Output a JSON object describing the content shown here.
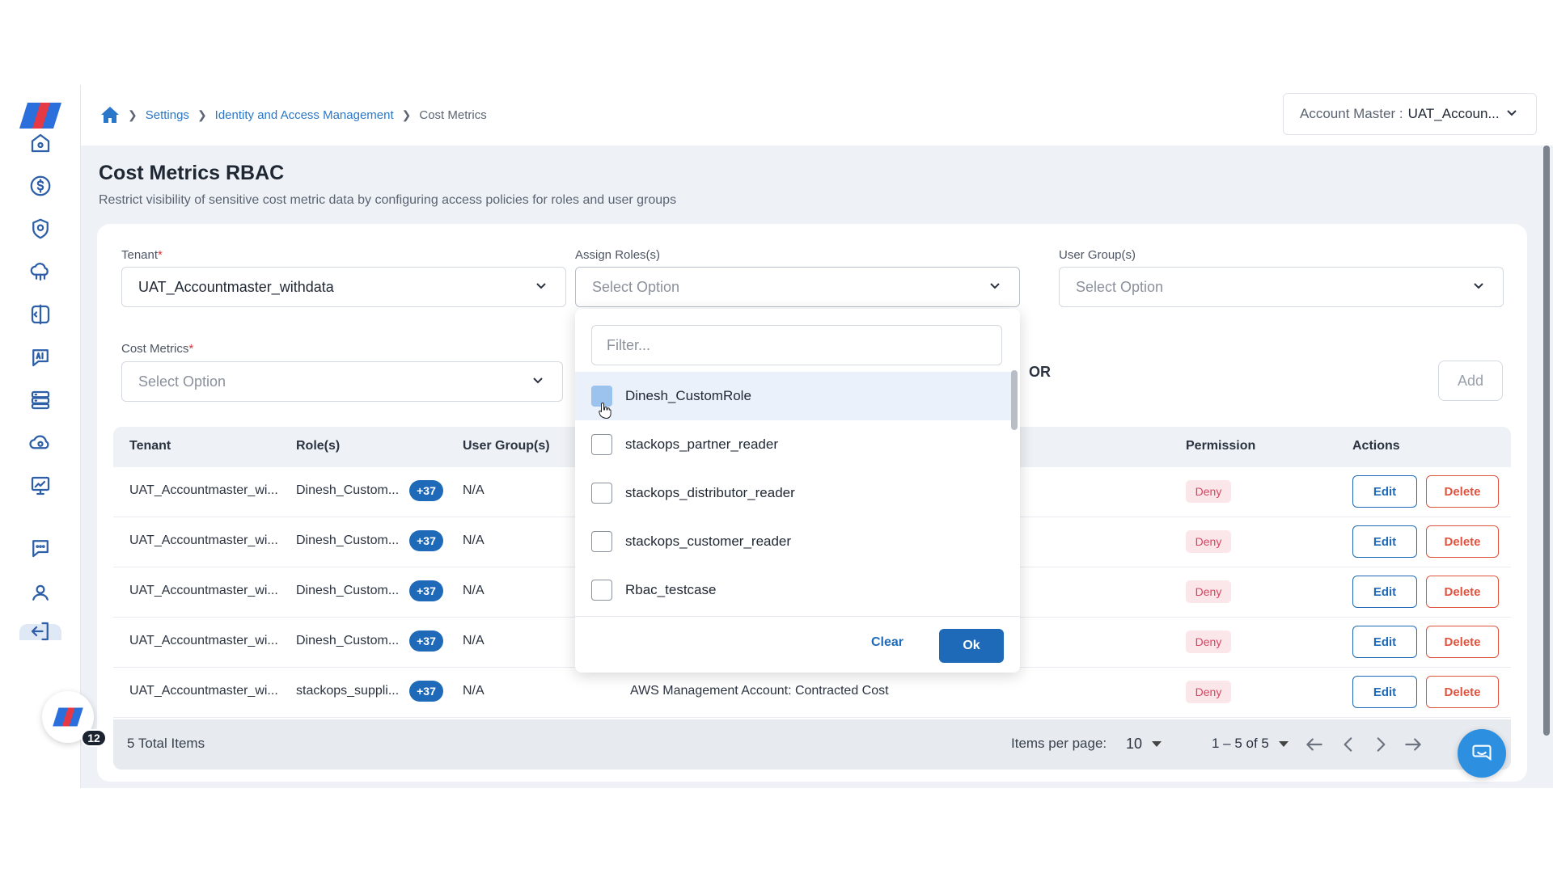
{
  "breadcrumb": {
    "items": [
      "Settings",
      "Identity and Access Management"
    ],
    "current": "Cost Metrics"
  },
  "account": {
    "label": "Account Master :",
    "value": "UAT_Accoun..."
  },
  "page": {
    "title": "Cost Metrics RBAC",
    "subtitle": "Restrict visibility of sensitive cost metric data by configuring access policies for roles and user groups"
  },
  "form": {
    "tenant_label": "Tenant",
    "tenant_value": "UAT_Accountmaster_withdata",
    "roles_label": "Assign Roles(s)",
    "roles_placeholder": "Select Option",
    "or_label": "OR",
    "groups_label": "User Group(s)",
    "groups_placeholder": "Select Option",
    "metrics_label": "Cost Metrics",
    "metrics_placeholder": "Select Option",
    "required_mark": "*",
    "add_label": "Add"
  },
  "dropdown": {
    "filter_placeholder": "Filter...",
    "options": [
      "Dinesh_CustomRole",
      "stackops_partner_reader",
      "stackops_distributor_reader",
      "stackops_customer_reader",
      "Rbac_testcase"
    ],
    "clear_label": "Clear",
    "ok_label": "Ok"
  },
  "table": {
    "headers": {
      "tenant": "Tenant",
      "roles": "Role(s)",
      "groups": "User Group(s)",
      "permission": "Permission",
      "actions": "Actions"
    },
    "rows": [
      {
        "tenant": "UAT_Accountmaster_wi...",
        "role": "Dinesh_Custom...",
        "more": "+37",
        "group": "N/A",
        "metric": "",
        "permission": "Deny"
      },
      {
        "tenant": "UAT_Accountmaster_wi...",
        "role": "Dinesh_Custom...",
        "more": "+37",
        "group": "N/A",
        "metric": "",
        "permission": "Deny"
      },
      {
        "tenant": "UAT_Accountmaster_wi...",
        "role": "Dinesh_Custom...",
        "more": "+37",
        "group": "N/A",
        "metric": "",
        "permission": "Deny"
      },
      {
        "tenant": "UAT_Accountmaster_wi...",
        "role": "Dinesh_Custom...",
        "more": "+37",
        "group": "N/A",
        "metric": "",
        "permission": "Deny"
      },
      {
        "tenant": "UAT_Accountmaster_wi...",
        "role": "stackops_suppli...",
        "more": "+37",
        "group": "N/A",
        "metric": "AWS Management Account: Contracted Cost",
        "permission": "Deny"
      }
    ],
    "edit_label": "Edit",
    "delete_label": "Delete"
  },
  "footer": {
    "total": "5 Total Items",
    "items_per_page_label": "Items per page:",
    "items_per_page": "10",
    "range": "1 – 5 of 5"
  },
  "notification_count": "12",
  "colors": {
    "primary": "#1f6ab8",
    "danger": "#e0533f",
    "deny_bg": "#fbe6ea",
    "accent_red": "#e63946",
    "accent_blue": "#2a6fdb"
  }
}
